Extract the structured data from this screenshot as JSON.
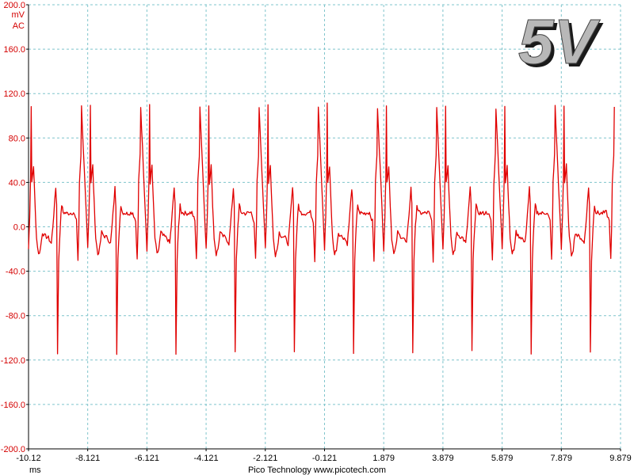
{
  "colors": {
    "trace": "#e00000",
    "grid": "#7fc4cc",
    "axis": "#000000",
    "y_labels": "#d40000",
    "x_labels": "#000000"
  },
  "overlay": {
    "badge_text": "5V"
  },
  "footer": {
    "text": "Pico Technology  www.picotech.com"
  },
  "chart_data": {
    "type": "line",
    "title": "",
    "y_unit": "mV",
    "y_coupling": "AC",
    "x_unit": "ms",
    "ylim": [
      -200.0,
      200.0
    ],
    "xlim": [
      -10.12,
      9.879
    ],
    "y_ticks": [
      "200.0",
      "160.0",
      "120.0",
      "80.0",
      "40.0",
      "0.0",
      "-40.0",
      "-80.0",
      "-120.0",
      "-160.0",
      "-200.0"
    ],
    "y_tick_values": [
      200,
      160,
      120,
      80,
      40,
      0,
      -40,
      -80,
      -120,
      -160,
      -200
    ],
    "x_ticks": [
      "-10.12",
      "-8.121",
      "-6.121",
      "-4.121",
      "-2.121",
      "-0.121",
      "1.879",
      "3.879",
      "5.879",
      "7.879",
      "9.879"
    ],
    "x_tick_values": [
      -10.12,
      -8.121,
      -6.121,
      -4.121,
      -2.121,
      -0.121,
      1.879,
      3.879,
      5.879,
      7.879,
      9.879
    ],
    "grid": true,
    "series": [
      {
        "color": "#e00000",
        "period_ms": 2.0,
        "first_peak_x": -10.03,
        "points": [
          [
            -10.12,
            -20
          ],
          [
            -10.08,
            10
          ],
          [
            -10.05,
            45
          ],
          [
            -10.03,
            110
          ],
          [
            -10.01,
            40
          ],
          [
            -9.95,
            55
          ],
          [
            -9.9,
            20
          ],
          [
            -9.85,
            -10
          ],
          [
            -9.78,
            -25
          ],
          [
            -9.72,
            -20
          ],
          [
            -9.65,
            -5
          ],
          [
            -9.58,
            -8
          ],
          [
            -9.45,
            -10
          ],
          [
            -9.35,
            -15
          ],
          [
            -9.3,
            0
          ],
          [
            -9.2,
            35
          ],
          [
            -9.17,
            20
          ],
          [
            -9.14,
            -113
          ],
          [
            -9.1,
            -30
          ],
          [
            -9.05,
            0
          ],
          [
            -9.0,
            20
          ],
          [
            -8.95,
            13
          ],
          [
            -8.8,
            12
          ],
          [
            -8.6,
            13
          ],
          [
            -8.5,
            5
          ],
          [
            -8.45,
            -30
          ],
          [
            -8.42,
            0
          ],
          [
            -8.4,
            40
          ],
          [
            -8.35,
            65
          ],
          [
            -8.33,
            108
          ]
        ]
      },
      {
        "color": "#e00000",
        "points": [
          [
            -8.121,
            60
          ],
          [
            -8.0,
            45
          ],
          [
            -7.9,
            10
          ],
          [
            -7.8,
            -20
          ],
          [
            -7.7,
            -28
          ],
          [
            -7.5,
            -5
          ],
          [
            -7.3,
            -8
          ],
          [
            -7.1,
            -20
          ],
          [
            -7.0,
            0
          ],
          [
            -6.9,
            35
          ],
          [
            -6.84,
            -115
          ],
          [
            -6.8,
            -25
          ],
          [
            -6.7,
            15
          ],
          [
            -6.5,
            13
          ],
          [
            -6.3,
            11
          ],
          [
            -6.2,
            5
          ],
          [
            -6.15,
            -30
          ],
          [
            -6.121,
            108
          ],
          [
            -6.0,
            45
          ]
        ]
      }
    ]
  }
}
